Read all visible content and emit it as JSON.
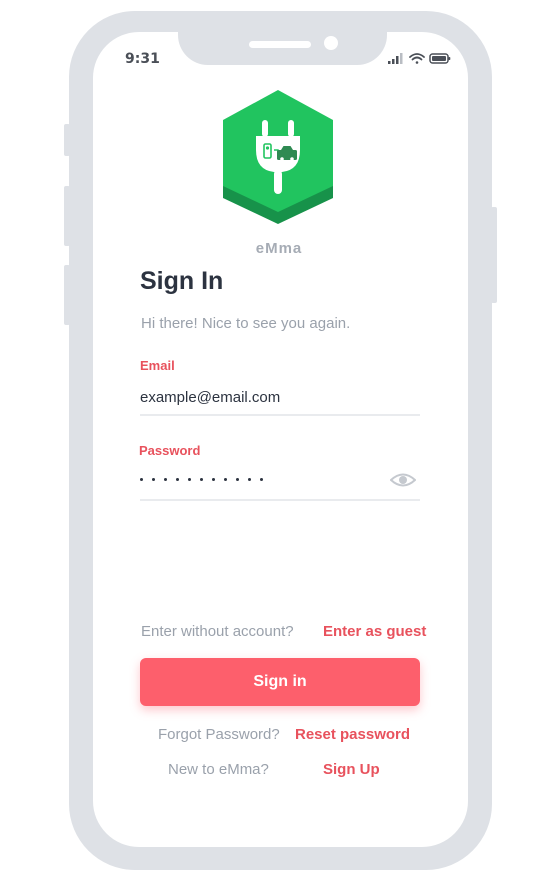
{
  "status_bar": {
    "time": "9:31",
    "signal_icon": "cellular-signal-icon",
    "wifi_icon": "wifi-icon",
    "battery_icon": "battery-icon"
  },
  "brand": {
    "app_name": "eMma",
    "logo_icon": "ev-plug-logo-icon",
    "colors": {
      "hex_green": "#21c45f",
      "hex_dark": "#17924a",
      "accent": "#fd5f6c"
    }
  },
  "header": {
    "title": "Sign In",
    "subtitle": "Hi there! Nice to see you again."
  },
  "form": {
    "email": {
      "label": "Email",
      "value": "example@email.com"
    },
    "password": {
      "label": "Password",
      "masked_length": 11,
      "toggle_icon": "eye-icon"
    }
  },
  "guest": {
    "prompt": "Enter without account?",
    "link": "Enter as guest"
  },
  "primary_button": {
    "label": "Sign in"
  },
  "forgot": {
    "prompt": "Forgot Password?",
    "link": "Reset password"
  },
  "signup": {
    "prompt": "New to eMma?",
    "link": "Sign Up"
  }
}
